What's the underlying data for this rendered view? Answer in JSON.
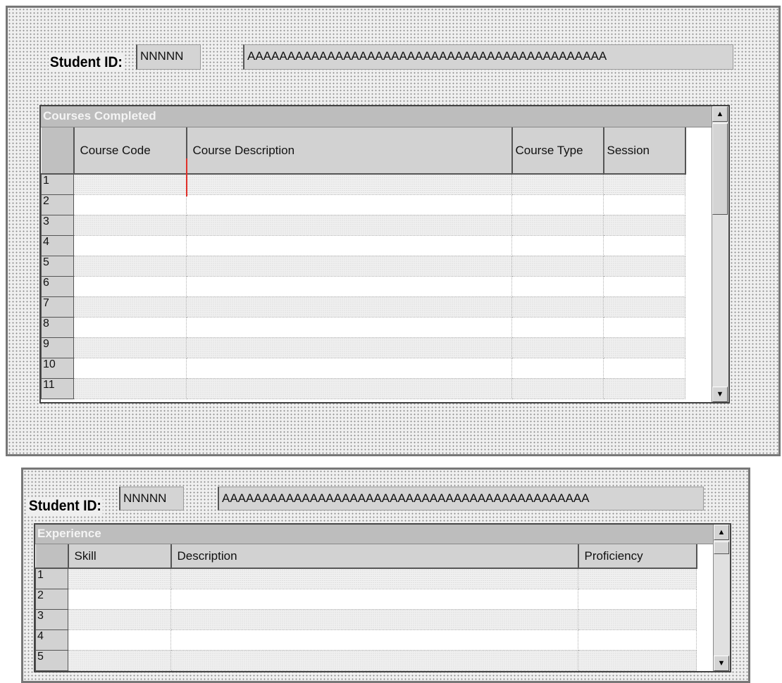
{
  "form1": {
    "student_id_label": "Student ID:",
    "student_id_value": "NNNNN",
    "name_value": "AAAAAAAAAAAAAAAAAAAAAAAAAAAAAAAAAAAAAAAAAAAAA",
    "grid": {
      "title": "Courses Completed",
      "columns": [
        "Course Code",
        "Course Description",
        "Course Type",
        "Session"
      ],
      "row_numbers": [
        "1",
        "2",
        "3",
        "4",
        "5",
        "6",
        "7",
        "8",
        "9",
        "10",
        "11"
      ]
    }
  },
  "form2": {
    "student_id_label": "Student ID:",
    "student_id_value": "NNNNN",
    "name_value": "AAAAAAAAAAAAAAAAAAAAAAAAAAAAAAAAAAAAAAAAAAAAAA",
    "grid": {
      "title": "Experience",
      "columns": [
        "Skill",
        "Description",
        "Proficiency"
      ],
      "row_numbers": [
        "1",
        "2",
        "3",
        "4",
        "5"
      ]
    }
  },
  "icons": {
    "scroll_up": "▲",
    "scroll_down": "▼"
  }
}
